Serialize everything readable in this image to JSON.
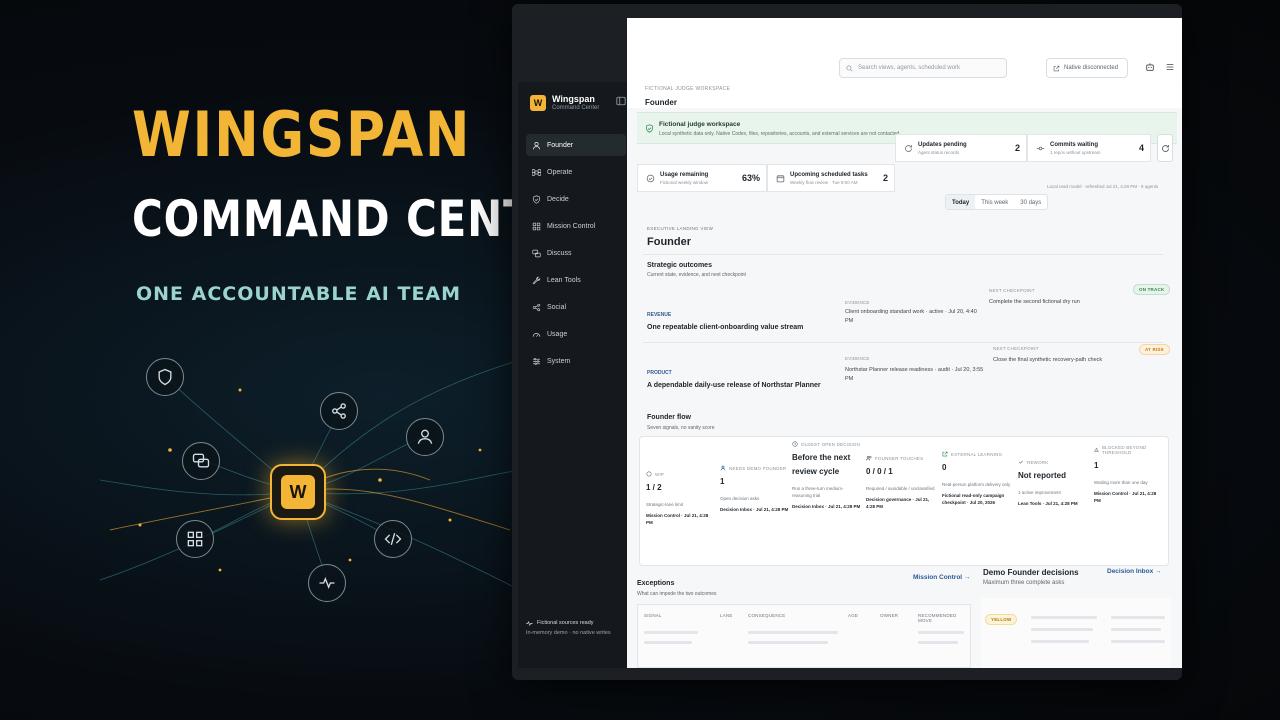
{
  "hero": {
    "title_line1": "WINGSPAN",
    "title_line2": "COMMAND CENTER",
    "tagline": "ONE ACCOUNTABLE AI TEAM",
    "hub_letter": "W"
  },
  "colors": {
    "accent": "#f2b535",
    "tagline": "#9ad3cf",
    "on_track": "#2f8a4a",
    "at_risk": "#c77a12",
    "link": "#2a5b9a"
  },
  "sidebar": {
    "brand_letter": "W",
    "brand_name": "Wingspan",
    "brand_sub": "Command Center",
    "items": [
      {
        "label": "Founder",
        "icon": "user-icon"
      },
      {
        "label": "Operate",
        "icon": "command-icon"
      },
      {
        "label": "Decide",
        "icon": "shield-check-icon"
      },
      {
        "label": "Mission Control",
        "icon": "grid-icon"
      },
      {
        "label": "Discuss",
        "icon": "chat-icon"
      },
      {
        "label": "Lean Tools",
        "icon": "wrench-icon"
      },
      {
        "label": "Social",
        "icon": "share-icon"
      },
      {
        "label": "Usage",
        "icon": "gauge-icon"
      },
      {
        "label": "System",
        "icon": "sliders-icon"
      }
    ],
    "footer_title": "Fictional sources ready",
    "footer_sub": "In-memory demo · no native writes"
  },
  "header": {
    "workspace_label": "FICTIONAL JUDGE WORKSPACE",
    "workspace_title": "Founder",
    "search_placeholder": "Search views, agents, scheduled work",
    "native_status": "Native disconnected"
  },
  "banner": {
    "title": "Fictional judge workspace",
    "subtitle": "Local synthetic data only. Native Codex, files, repositories, accounts, and external services are not contacted."
  },
  "stats": [
    {
      "title": "Updates pending",
      "sub": "Agent status records",
      "value": "2",
      "icon": "refresh-icon"
    },
    {
      "title": "Commits waiting",
      "sub": "1 repos without upstream",
      "value": "4",
      "icon": "commit-icon"
    },
    {
      "title": "Usage remaining",
      "sub": "Fictional weekly window",
      "value": "63%",
      "icon": "check-circle-icon"
    },
    {
      "title": "Upcoming scheduled tasks",
      "sub": "Weekly flow review · Tue 9:00 AM",
      "value": "2",
      "icon": "calendar-icon"
    }
  ],
  "range": {
    "options": [
      "Today",
      "This week",
      "30 days"
    ],
    "selected": "Today",
    "local_read": "Local read model · refreshed Jul 21, 4:28 PM · 8 agents"
  },
  "executive": {
    "label": "EXECUTIVE LANDING VIEW",
    "title": "Founder",
    "outcomes_title": "Strategic outcomes",
    "outcomes_sub": "Current state, evidence, and next checkpoint",
    "evidence_label": "EVIDENCE",
    "checkpoint_label": "NEXT CHECKPOINT",
    "outcomes": [
      {
        "tag": "REVENUE",
        "title": "One repeatable client-onboarding value stream",
        "evidence": "Client onboarding standard work · active · Jul 20, 4:40 PM",
        "checkpoint": "Complete the second fictional dry run",
        "status": "ON TRACK"
      },
      {
        "tag": "PRODUCT",
        "title": "A dependable daily-use release of Northstar Planner",
        "evidence": "Northstar Planner release readiness · audit · Jul 20, 3:55 PM",
        "checkpoint": "Close the final synthetic recovery-path check",
        "status": "AT RISK"
      }
    ]
  },
  "flow": {
    "title": "Founder flow",
    "sub": "Seven signals, no vanity score",
    "columns": [
      {
        "label": "WIP",
        "value": "1 / 2",
        "sub": "Strategic-lane limit",
        "src": "Mission Control · Jul 21, 4:28 PM",
        "icon": "wip-icon"
      },
      {
        "label": "NEEDS DEMO FOUNDER",
        "value": "1",
        "sub": "Open decision asks",
        "src": "Decision Inbox · Jul 21, 4:28 PM",
        "icon": "user-icon"
      },
      {
        "label": "OLDEST OPEN DECISION",
        "value": "Before the next review cycle",
        "sub": "Run a three-turn medium-reasoning trial",
        "src": "Decision Inbox · Jul 21, 4:28 PM",
        "icon": "clock-icon"
      },
      {
        "label": "FOUNDER TOUCHES",
        "value": "0 / 0 / 1",
        "sub": "Required / avoidable / unclassified",
        "src": "Decision governance · Jul 21, 4:28 PM",
        "icon": "users-icon"
      },
      {
        "label": "EXTERNAL LEARNING",
        "value": "0",
        "sub": "Real-person platform delivery only",
        "src": "Fictional read-only campaign checkpoint · Jul 20, 2026",
        "icon": "external-icon"
      },
      {
        "label": "REWORK",
        "value": "Not reported",
        "sub": "1 active improvement",
        "src": "Lean Tools · Jul 21, 4:28 PM",
        "icon": "rework-icon"
      },
      {
        "label": "BLOCKED BEYOND THRESHOLD",
        "value": "1",
        "sub": "Waiting more than one day",
        "src": "Mission Control · Jul 21, 4:28 PM",
        "icon": "warning-icon"
      }
    ]
  },
  "exceptions": {
    "title": "Exceptions",
    "sub": "What can impede the two outcomes",
    "link": "Mission Control",
    "columns": [
      "SIGNAL",
      "LANE",
      "CONSEQUENCE",
      "AGE",
      "OWNER",
      "RECOMMENDED MOVE"
    ]
  },
  "decisions": {
    "title": "Demo Founder decisions",
    "sub": "Maximum three complete asks",
    "link": "Decision Inbox",
    "badge": "YELLOW"
  }
}
